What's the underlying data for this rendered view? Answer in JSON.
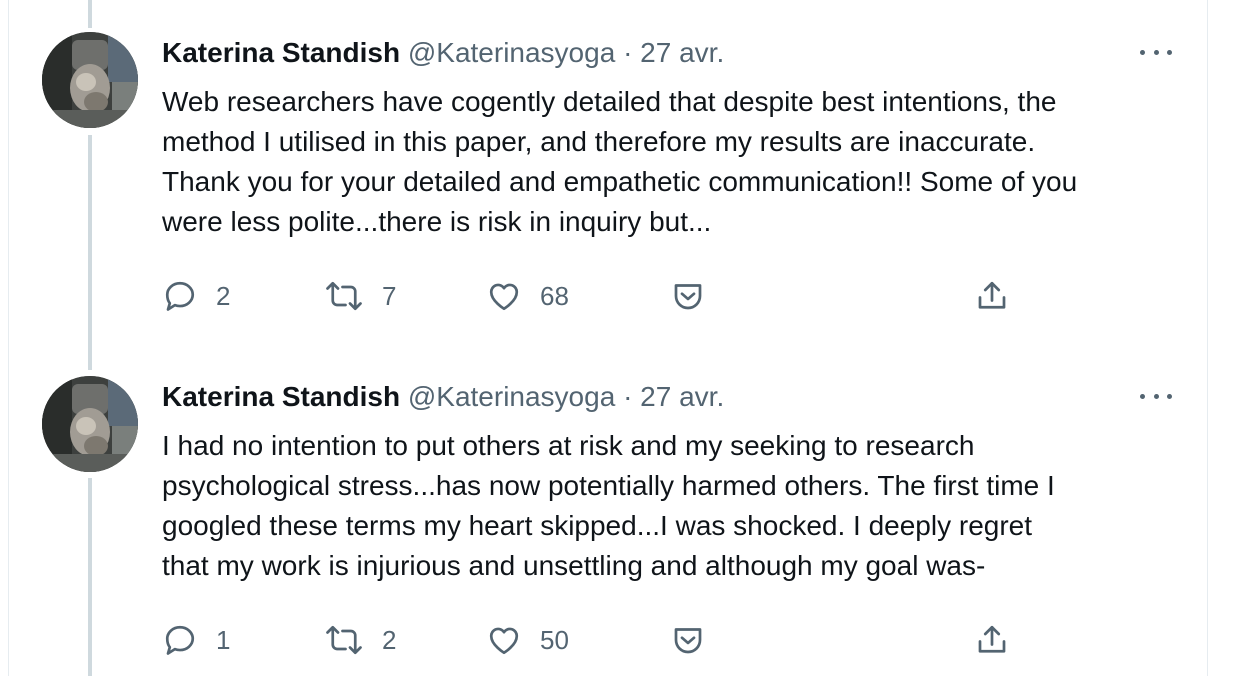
{
  "tweets": [
    {
      "author_name": "Katerina Standish",
      "handle": "@Katerinasyoga",
      "separator": "·",
      "date": "27 avr.",
      "lines": [
        "Web researchers have cogently detailed that despite best intentions, the",
        "method I utilised in this paper, and therefore my results are inaccurate.",
        "Thank you for your detailed and empathetic communication!! Some of you",
        "were less polite...there is risk in inquiry but..."
      ],
      "replies": "2",
      "retweets": "7",
      "likes": "68",
      "icons": {
        "reply": "reply-icon",
        "retweet": "retweet-icon",
        "like": "heart-icon",
        "tip": "tip-icon",
        "share": "share-icon",
        "more": "more-icon"
      }
    },
    {
      "author_name": "Katerina Standish",
      "handle": "@Katerinasyoga",
      "separator": "·",
      "date": "27 avr.",
      "lines": [
        "I had no intention to put others at risk and my seeking to research",
        "psychological stress...has now potentially harmed others. The first time I",
        "googled these terms my heart skipped...I was shocked. I deeply regret",
        "that my work is injurious and unsettling and although my goal was-"
      ],
      "replies": "1",
      "retweets": "2",
      "likes": "50",
      "icons": {
        "reply": "reply-icon",
        "retweet": "retweet-icon",
        "like": "heart-icon",
        "tip": "tip-icon",
        "share": "share-icon",
        "more": "more-icon"
      }
    }
  ],
  "colors": {
    "text": "#0f1419",
    "secondary": "#536471",
    "thread_line": "#cfd9de",
    "border": "#e6ecf0"
  }
}
